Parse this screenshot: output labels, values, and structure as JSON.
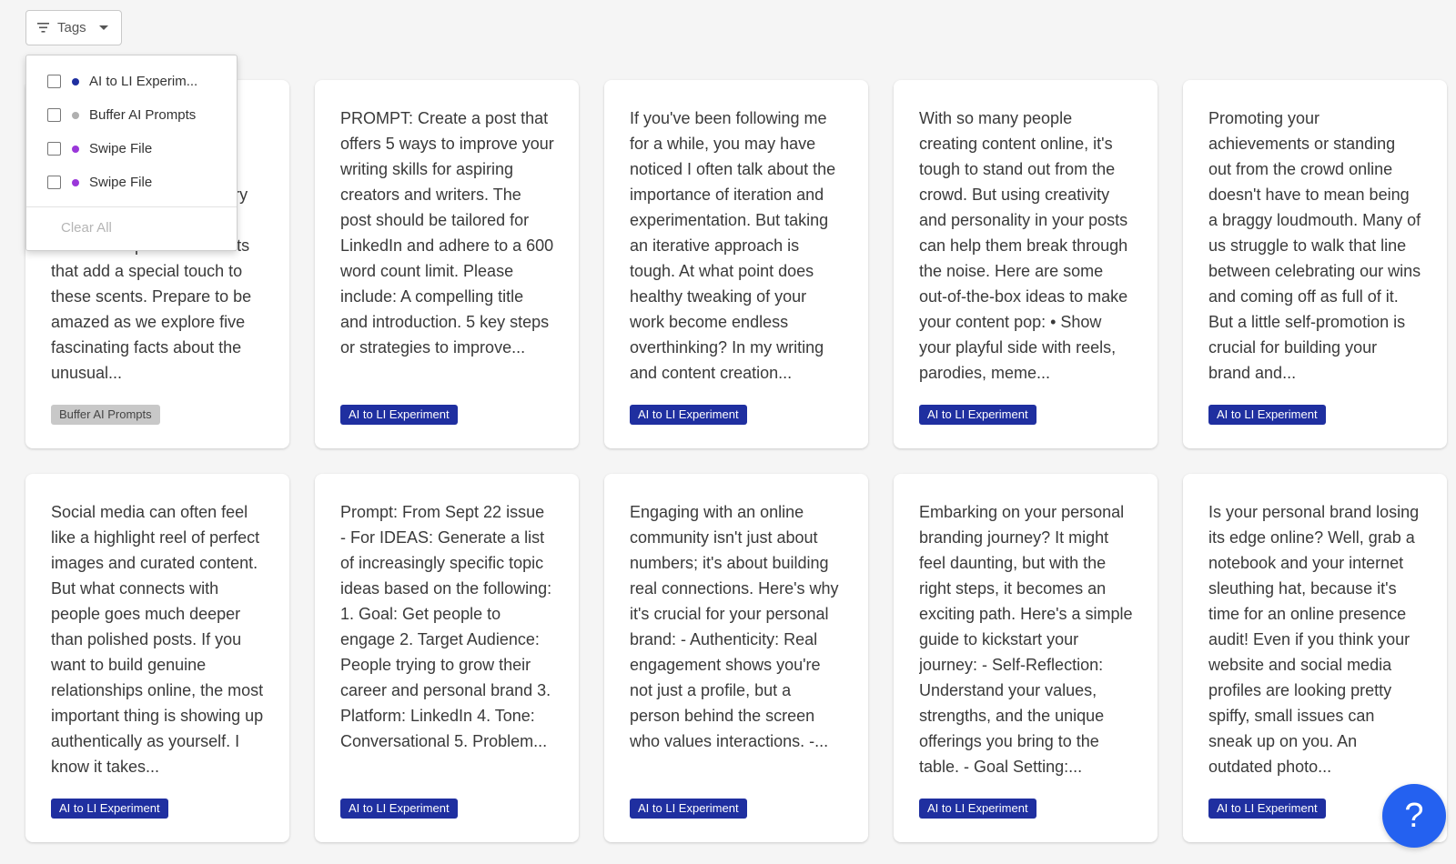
{
  "filter": {
    "label": "Tags"
  },
  "dropdown": {
    "items": [
      {
        "label": "AI to LI Experim...",
        "color": "#1f2fa0",
        "checked": false
      },
      {
        "label": "Buffer AI Prompts",
        "color": "#b0b0b0",
        "checked": false
      },
      {
        "label": "Swipe File",
        "color": "#9a37d9",
        "checked": false
      },
      {
        "label": "Swipe File",
        "color": "#9a37d9",
        "checked": false
      }
    ],
    "clear_label": "Clear All"
  },
  "cards": [
    {
      "text": "Fragrances tell stories. Discover the intriguing scents out there — from ocean mist to fresh laundry — and the creative, sometimes poetic elements that add a special touch to these scents. Prepare to be amazed as we explore five fascinating facts about the unusual...",
      "tag": "Buffer AI Prompts",
      "tag_style": "grey"
    },
    {
      "text": "PROMPT: Create a post that offers 5 ways to improve your writing skills for aspiring creators and writers. The post should be tailored for LinkedIn and adhere to a 600 word count limit. Please include: A compelling title and introduction. 5 key steps or strategies to improve...",
      "tag": "AI to LI Experiment",
      "tag_style": "blue"
    },
    {
      "text": "If you've been following me for a while, you may have noticed I often talk about the importance of iteration and experimentation. But taking an iterative approach is tough. At what point does healthy tweaking of your work become endless overthinking? In my writing and content creation...",
      "tag": "AI to LI Experiment",
      "tag_style": "blue"
    },
    {
      "text": "With so many people creating content online, it's tough to stand out from the crowd. But using creativity and personality in your posts can help them break through the noise. Here are some out-of-the-box ideas to make your content pop: • Show your playful side with reels, parodies, meme...",
      "tag": "AI to LI Experiment",
      "tag_style": "blue"
    },
    {
      "text": "Promoting your achievements or standing out from the crowd online doesn't have to mean being a braggy loudmouth. Many of us struggle to walk that line between celebrating our wins and coming off as full of it. But a little self-promotion is crucial for building your brand and...",
      "tag": "AI to LI Experiment",
      "tag_style": "blue"
    },
    {
      "text": "Social media can often feel like a highlight reel of perfect images and curated content. But what connects with people goes much deeper than polished posts. If you want to build genuine relationships online, the most important thing is showing up authentically as yourself. I know it takes...",
      "tag": "AI to LI Experiment",
      "tag_style": "blue"
    },
    {
      "text": "Prompt: From Sept 22 issue - For IDEAS: Generate a list of increasingly specific topic ideas based on the following: 1. Goal: Get people to engage 2. Target Audience: People trying to grow their career and personal brand 3. Platform: LinkedIn 4. Tone: Conversational 5. Problem...",
      "tag": "AI to LI Experiment",
      "tag_style": "blue"
    },
    {
      "text": "Engaging with an online community isn't just about numbers; it's about building real connections. Here's why it's crucial for your personal brand: - Authenticity: Real engagement shows you're not just a profile, but a person behind the screen who values interactions. -...",
      "tag": "AI to LI Experiment",
      "tag_style": "blue"
    },
    {
      "text": "Embarking on your personal branding journey? It might feel daunting, but with the right steps, it becomes an exciting path. Here's a simple guide to kickstart your journey: - Self-Reflection: Understand your values, strengths, and the unique offerings you bring to the table. - Goal Setting:...",
      "tag": "AI to LI Experiment",
      "tag_style": "blue"
    },
    {
      "text": "Is your personal brand losing its edge online? Well, grab a notebook and your internet sleuthing hat, because it's time for an online presence audit! Even if you think your website and social media profiles are looking pretty spiffy, small issues can sneak up on you. An outdated photo...",
      "tag": "AI to LI Experiment",
      "tag_style": "blue"
    }
  ],
  "help": {
    "label": "?"
  }
}
